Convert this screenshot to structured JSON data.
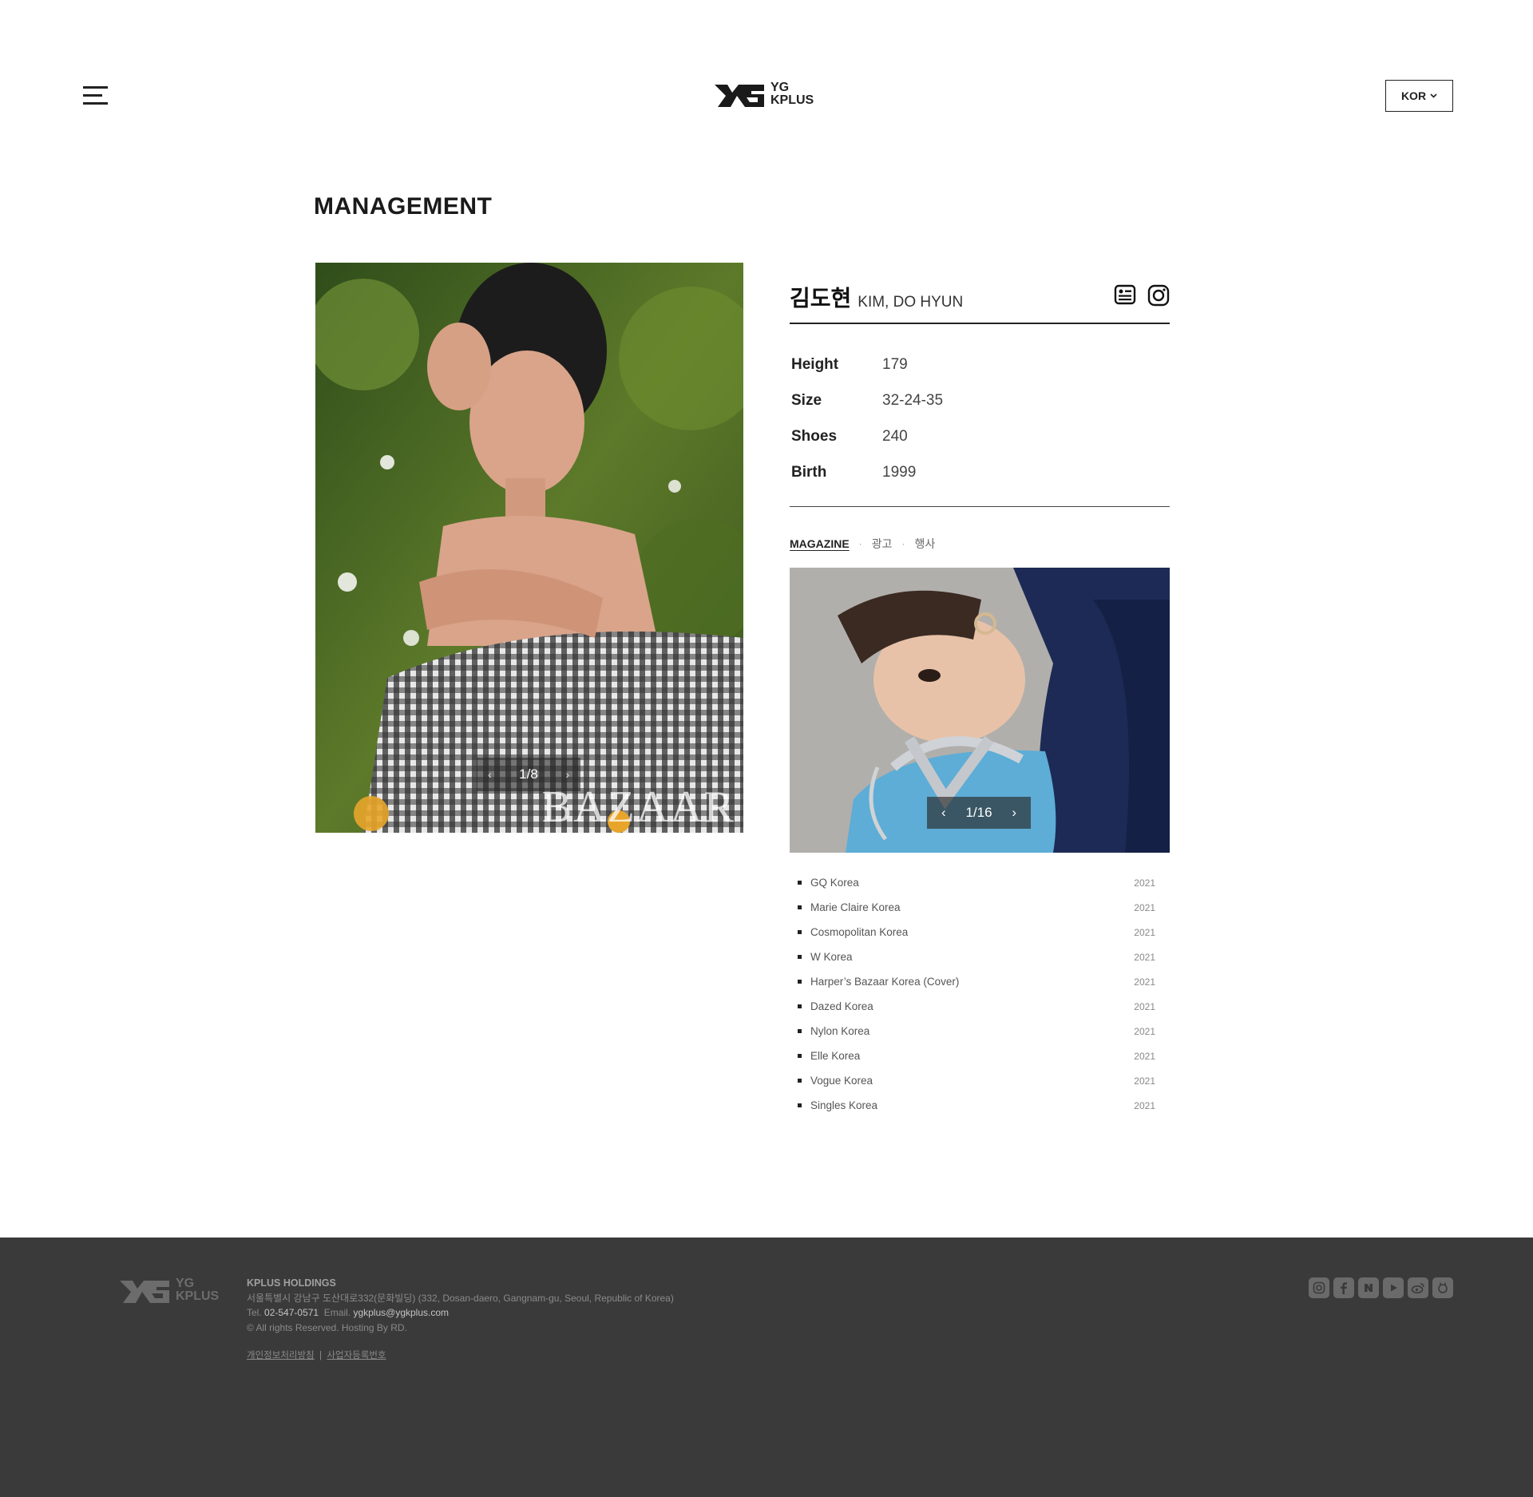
{
  "header": {
    "logo_line1": "YG",
    "logo_line2": "KPLUS",
    "lang_label": "KOR"
  },
  "page": {
    "title": "MANAGEMENT"
  },
  "main_photo": {
    "counter": "1/8",
    "watermark": "BAZAAR"
  },
  "profile": {
    "name_ko": "김도현",
    "name_en": "KIM, DO HYUN",
    "stats": [
      {
        "label": "Height",
        "value": "179"
      },
      {
        "label": "Size",
        "value": "32-24-35"
      },
      {
        "label": "Shoes",
        "value": "240"
      },
      {
        "label": "Birth",
        "value": "1999"
      }
    ],
    "tabs": [
      {
        "label": "MAGAZINE",
        "active": true
      },
      {
        "label": "광고",
        "active": false
      },
      {
        "label": "행사",
        "active": false
      }
    ],
    "sub_photo_counter": "1/16",
    "magazines": [
      {
        "name": "GQ Korea",
        "year": "2021"
      },
      {
        "name": "Marie Claire Korea",
        "year": "2021"
      },
      {
        "name": "Cosmopolitan Korea",
        "year": "2021"
      },
      {
        "name": "W Korea",
        "year": "2021"
      },
      {
        "name": "Harper’s Bazaar Korea (Cover)",
        "year": "2021"
      },
      {
        "name": "Dazed Korea",
        "year": "2021"
      },
      {
        "name": "Nylon Korea",
        "year": "2021"
      },
      {
        "name": "Elle Korea",
        "year": "2021"
      },
      {
        "name": "Vogue Korea",
        "year": "2021"
      },
      {
        "name": "Singles Korea",
        "year": "2021"
      }
    ]
  },
  "footer": {
    "logo_line1": "YG",
    "logo_line2": "KPLUS",
    "company": "KPLUS HOLDINGS",
    "address": "서울특별시 강남구 도산대로332(문화빌딩) (332, Dosan-daero, Gangnam-gu, Seoul, Republic of Korea)",
    "tel_label": "Tel.",
    "tel": "02-547-0571",
    "email_label": "Email.",
    "email": "ygkplus@ygkplus.com",
    "rights": "© All rights Reserved. Hosting By RD.",
    "link_privacy": "개인정보처리방침",
    "link_separator": "|",
    "link_business": "사업자등록번호",
    "social_icons": [
      "instagram-icon",
      "facebook-icon",
      "naver-icon",
      "youtube-icon",
      "weibo-icon",
      "line-icon"
    ]
  }
}
